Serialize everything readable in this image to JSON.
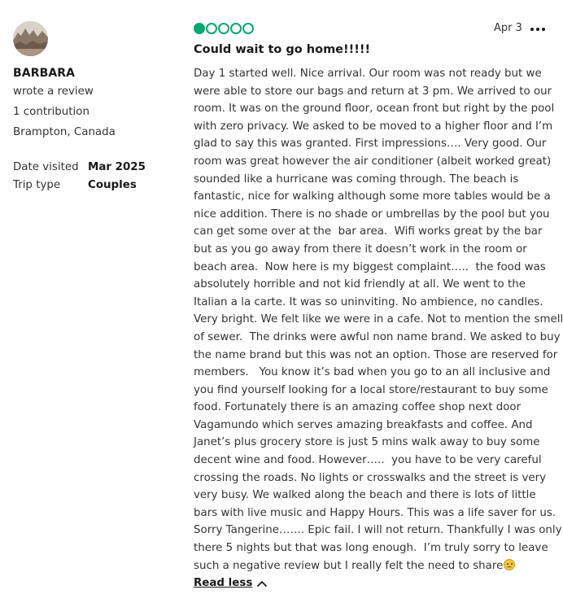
{
  "reviewer": {
    "name": "BARBARA",
    "action": "wrote a review",
    "contributions": "1 contribution",
    "location": "Brampton, Canada",
    "date_visited_label": "Date visited",
    "date_visited_value": "Mar 2025",
    "trip_type_label": "Trip type",
    "trip_type_value": "Couples",
    "avatar_icon": "avatar-photo"
  },
  "review": {
    "rating": 1,
    "rating_max": 5,
    "rating_color": "#00aa6c",
    "date": "Apr 3",
    "more_icon": "more-options-icon",
    "title": "Could wait to go home!!!!!",
    "body_lines": [
      "Day 1 started well. Nice arrival. Our room was not ready but we",
      "were able to store our bags and return at 3 pm. We arrived to our",
      "room. It was on the ground floor, ocean front but right by the pool",
      "with zero privacy. We asked to be moved to a higher floor and I’m",
      "glad to say this was granted. First impressions…. Very good. Our",
      "room was great however the air conditioner (albeit worked great)",
      "sounded like a hurricane was coming through. The beach is",
      "fantastic, nice for walking although some more tables would be a",
      "nice addition. There is no shade or umbrellas by the pool but you",
      "can get some over at the  bar area.  Wifi works great by the bar",
      "but as you go away from there it doesn’t work in the room or",
      "beach area.  Now here is my biggest complaint…..  the food was",
      "absolutely horrible and not kid friendly at all. We went to the",
      "Italian a la carte. It was so uninviting. No ambience, no candles.",
      "Very bright. We felt like we were in a cafe. Not to mention the smell",
      "of sewer.  The drinks were awful non name brand. We asked to buy",
      "the name brand but this was not an option. Those are reserved for",
      "members.   You know it’s bad when you go to an all inclusive and",
      "you find yourself looking for a local store/restaurant to buy some",
      "food. Fortunately there is an amazing coffee shop next door",
      "Vagamundo which serves amazing breakfasts and coffee. And",
      "Janet’s plus grocery store is just 5 mins walk away to buy some",
      "decent wine and food. However…..  you have to be very careful",
      "crossing the roads. No lights or crosswalks and the street is very",
      "very busy. We walked along the beach and there is lots of little",
      "bars with live music and Happy Hours. This was a life saver for us.",
      "Sorry Tangerine……. Epic fail. I will not return. Thankfully I was only",
      "there 5 nights but that was long enough.  I’m truly sorry to leave",
      "such a negative review but I really felt the need to share"
    ],
    "emoji_icon": "frowning-face-icon",
    "read_less_label": "Read less",
    "read_less_icon": "chevron-up-icon"
  }
}
